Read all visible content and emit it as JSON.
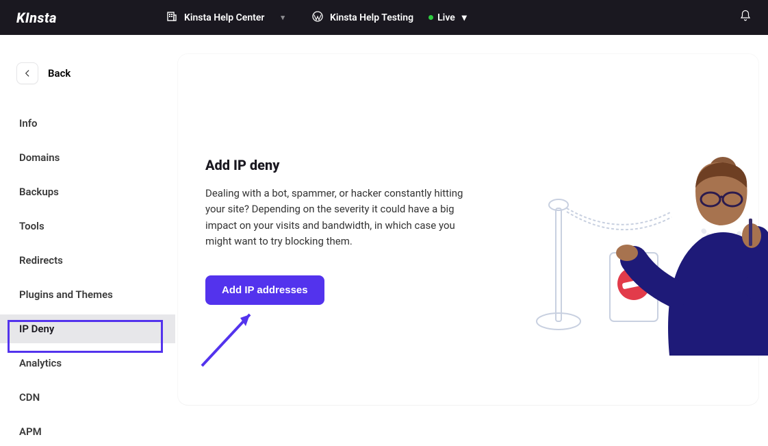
{
  "brand": "KInsta",
  "topbar": {
    "company_selector": "Kinsta Help Center",
    "site_selector": "Kinsta Help Testing",
    "env_label": "Live"
  },
  "sidebar": {
    "back_label": "Back",
    "items": [
      {
        "label": "Info"
      },
      {
        "label": "Domains"
      },
      {
        "label": "Backups"
      },
      {
        "label": "Tools"
      },
      {
        "label": "Redirects"
      },
      {
        "label": "Plugins and Themes"
      },
      {
        "label": "IP Deny"
      },
      {
        "label": "Analytics"
      },
      {
        "label": "CDN"
      },
      {
        "label": "APM"
      }
    ],
    "active_index": 6
  },
  "main": {
    "title": "Add IP deny",
    "description": "Dealing with a bot, spammer, or hacker constantly hitting your site? Depending on the severity it could have a big impact on your visits and bandwidth, in which case you might want to try blocking them.",
    "button_label": "Add IP addresses"
  },
  "colors": {
    "accent": "#5333ed",
    "navy": "#1e1a78",
    "dark": "#1a1820"
  }
}
